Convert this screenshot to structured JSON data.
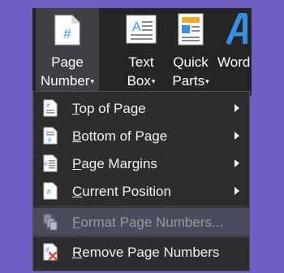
{
  "ribbon": {
    "page_number": {
      "line1": "Page",
      "line2": "Number",
      "icon": "page-number-icon"
    },
    "text_box": {
      "line1": "Text",
      "line2": "Box",
      "icon": "text-box-icon"
    },
    "quick_parts": {
      "line1": "Quick",
      "line2": "Parts",
      "icon": "quick-parts-icon"
    },
    "wordart": {
      "line1": "Word",
      "icon": "wordart-icon"
    },
    "dropdown_arrow": "▾"
  },
  "menu": {
    "items": [
      {
        "access": "T",
        "rest": "op of Page",
        "icon": "page-top-icon",
        "has_submenu": true
      },
      {
        "access": "B",
        "rest": "ottom of Page",
        "icon": "page-bottom-icon",
        "has_submenu": true
      },
      {
        "access": "P",
        "rest": "age Margins",
        "icon": "page-margins-icon",
        "has_submenu": true
      },
      {
        "access": "C",
        "rest": "urrent Position",
        "icon": "current-position-icon",
        "has_submenu": true
      },
      {
        "access": "F",
        "rest": "ormat Page Numbers...",
        "icon": "format-page-numbers-icon",
        "has_submenu": false,
        "disabled": true,
        "highlighted": true
      },
      {
        "access": "R",
        "rest": "emove Page Numbers",
        "icon": "remove-page-numbers-icon",
        "has_submenu": false
      }
    ]
  },
  "colors": {
    "background": "#6f5fc2",
    "ribbon": "#252526",
    "menu": "#2d2d30",
    "accent": "#3a8ee6",
    "remove_x": "#e04a3a"
  }
}
